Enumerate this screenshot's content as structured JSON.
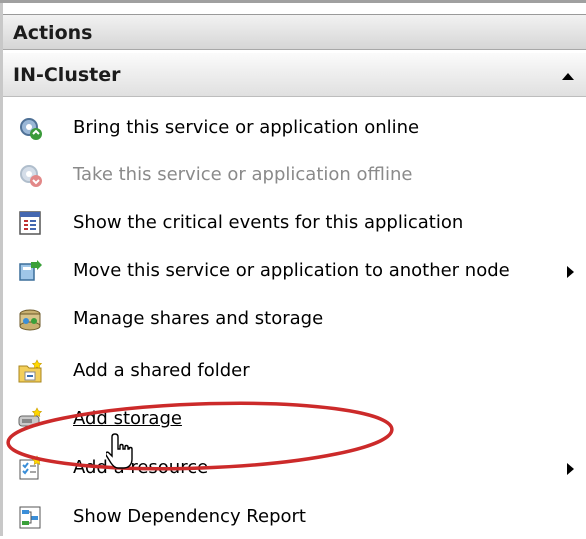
{
  "header": {
    "title": "Actions"
  },
  "group": {
    "title": "IN-Cluster"
  },
  "items": [
    {
      "label": "Bring this service or application online",
      "icon": "gear-online-icon",
      "disabled": false,
      "submenu": false
    },
    {
      "label": "Take this service or application offline",
      "icon": "gear-offline-icon",
      "disabled": true,
      "submenu": false
    },
    {
      "label": "Show the critical events for this application",
      "icon": "event-log-icon",
      "disabled": false,
      "submenu": false
    },
    {
      "label": "Move this service or application to another node",
      "icon": "move-node-icon",
      "disabled": false,
      "submenu": true
    },
    {
      "label": "Manage shares and storage",
      "icon": "manage-shares-icon",
      "disabled": false,
      "submenu": false
    },
    {
      "label": "Add a shared folder",
      "icon": "shared-folder-icon",
      "disabled": false,
      "submenu": false
    },
    {
      "label": "Add storage",
      "icon": "add-storage-icon",
      "disabled": false,
      "submenu": false
    },
    {
      "label": "Add a resource",
      "icon": "add-resource-icon",
      "disabled": false,
      "submenu": true
    },
    {
      "label": "Show Dependency Report",
      "icon": "dependency-report-icon",
      "disabled": false,
      "submenu": false
    }
  ],
  "colors": {
    "highlight_ellipse": "#cc2a2a",
    "disabled_text": "#8a8a8a"
  }
}
